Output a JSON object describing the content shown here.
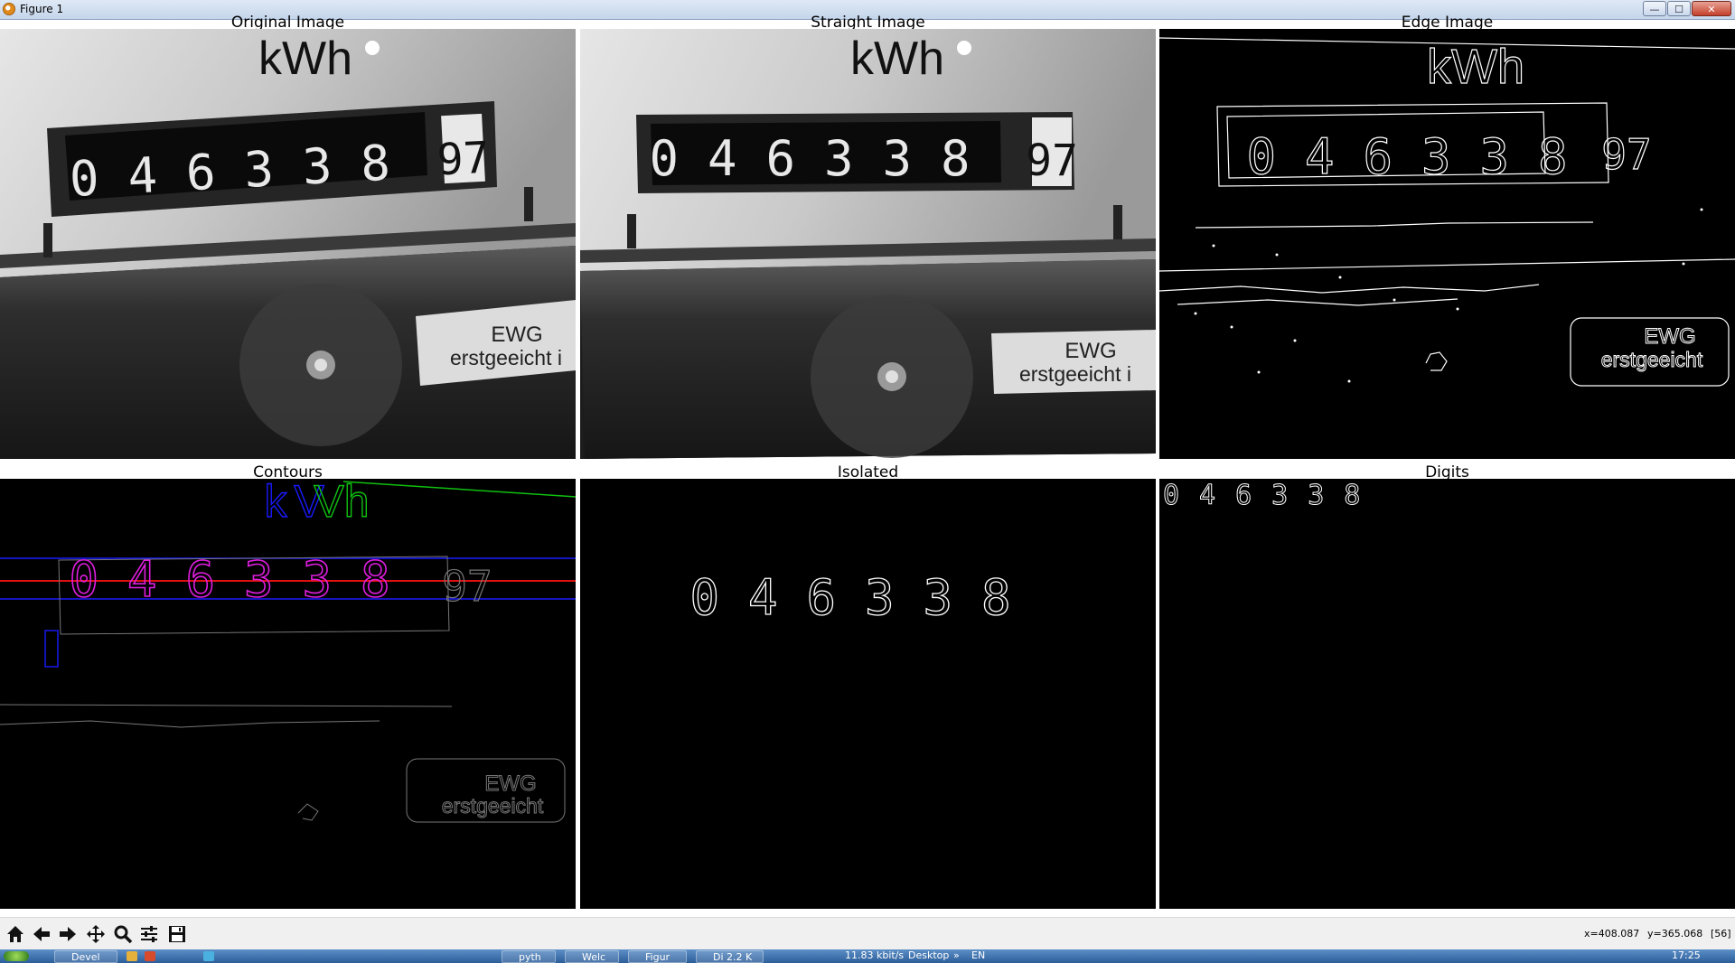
{
  "window": {
    "title": "Figure 1",
    "minimize_glyph": "—",
    "maximize_glyph": "☐",
    "close_glyph": "✕"
  },
  "panels": {
    "original": {
      "title": "Original Image",
      "kwh": "kWh",
      "digits": "046338",
      "last_digits": "97",
      "label_line1": "EWG",
      "label_line2": "erstgeeicht i"
    },
    "straight": {
      "title": "Straight Image",
      "kwh": "kWh",
      "digits": "046338",
      "last_digits": "97",
      "label_line1": "EWG",
      "label_line2": "erstgeeicht i"
    },
    "edge": {
      "title": "Edge Image",
      "kwh": "kWh",
      "digits": "046338",
      "last_digits": "97",
      "label_line1": "EWG",
      "label_line2": "erstgeeicht"
    },
    "contours": {
      "title": "Contours",
      "kwh_k": "k",
      "kwh_v": "V",
      "kwh_h": "Vh",
      "digits": "046338",
      "last_digits": "97",
      "label_line1": "EWG",
      "label_line2": "erstgeeicht"
    },
    "isolated": {
      "title": "Isolated",
      "digits": "046338"
    },
    "digits": {
      "title": "Digits",
      "digits": "046338"
    }
  },
  "toolbar": {
    "tools": [
      {
        "name": "home-icon",
        "glyph": "⌂"
      },
      {
        "name": "back-icon",
        "glyph": "←"
      },
      {
        "name": "forward-icon",
        "glyph": "→"
      },
      {
        "name": "pan-icon",
        "glyph": "✥"
      },
      {
        "name": "zoom-icon",
        "glyph": "🔍"
      },
      {
        "name": "configure-subplots-icon",
        "glyph": "≡"
      },
      {
        "name": "save-icon",
        "glyph": "💾"
      }
    ],
    "coord_x": "x=408.087",
    "coord_y": "y=365.068",
    "pixel_value": "[56]"
  },
  "taskbar": {
    "items": [
      "Devel",
      "pyth",
      "Welc",
      "Figur",
      "Di 2.2 K"
    ],
    "network": "11.83 kbit/s",
    "desktop": "Desktop",
    "chevron": "»",
    "lang": "EN",
    "clock": "17:25"
  },
  "colors": {
    "contour_blue": "#1a1aff",
    "contour_green": "#10c010",
    "contour_magenta": "#e01ee0",
    "contour_red": "#e01010"
  }
}
